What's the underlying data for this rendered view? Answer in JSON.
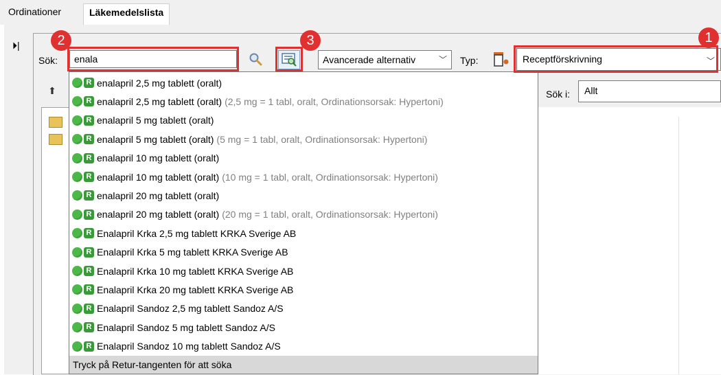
{
  "tabs": [
    {
      "label": "Ordinationer"
    },
    {
      "label": "Läkemedelslista"
    }
  ],
  "toolbar": {
    "collapse_glyph": "⏵|",
    "search_label": "Sök:",
    "search_value": "enala",
    "advanced_value": "Avancerade alternativ",
    "type_label": "Typ:",
    "type_value": "Receptförskrivning",
    "sok_i_label": "Sök i:",
    "sok_i_value": "Allt"
  },
  "annotations": [
    "2",
    "3",
    "1"
  ],
  "results": [
    {
      "name": "enalapril 2,5 mg tablett (oralt)",
      "detail": ""
    },
    {
      "name": "enalapril 2,5 mg tablett (oralt)",
      "detail": "(2,5 mg = 1 tabl, oralt, Ordinationsorsak: Hypertoni)"
    },
    {
      "name": "enalapril 5 mg tablett (oralt)",
      "detail": ""
    },
    {
      "name": "enalapril 5 mg tablett (oralt)",
      "detail": "(5 mg = 1 tabl, oralt, Ordinationsorsak: Hypertoni)"
    },
    {
      "name": "enalapril 10 mg tablett (oralt)",
      "detail": ""
    },
    {
      "name": "enalapril 10 mg tablett (oralt)",
      "detail": "(10 mg = 1 tabl, oralt, Ordinationsorsak: Hypertoni)"
    },
    {
      "name": "enalapril 20 mg tablett (oralt)",
      "detail": ""
    },
    {
      "name": "enalapril 20 mg tablett (oralt)",
      "detail": "(20 mg = 1 tabl, oralt, Ordinationsorsak: Hypertoni)"
    },
    {
      "name": "Enalapril Krka 2,5 mg tablett KRKA Sverige AB",
      "detail": ""
    },
    {
      "name": "Enalapril Krka 5 mg tablett KRKA Sverige AB",
      "detail": ""
    },
    {
      "name": "Enalapril Krka 10 mg tablett KRKA Sverige AB",
      "detail": ""
    },
    {
      "name": "Enalapril Krka 20 mg tablett KRKA Sverige AB",
      "detail": ""
    },
    {
      "name": "Enalapril Sandoz 2,5 mg tablett Sandoz A/S",
      "detail": ""
    },
    {
      "name": "Enalapril Sandoz 5 mg tablett Sandoz A/S",
      "detail": ""
    },
    {
      "name": "Enalapril Sandoz 10 mg tablett Sandoz A/S",
      "detail": ""
    }
  ],
  "result_badge": "R",
  "hint": "Tryck på Retur-tangenten för att söka",
  "colors": {
    "highlight": "#e03030",
    "status_green": "#4cb848"
  }
}
